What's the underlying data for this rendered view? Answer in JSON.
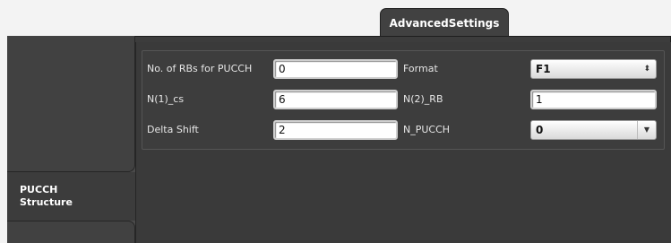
{
  "tabs": {
    "top": "AdvancedSettings",
    "side_line1": "PUCCH",
    "side_line2": "Structure"
  },
  "form": {
    "rbs_label": "No. of RBs for PUCCH",
    "rbs_value": "0",
    "n1cs_label": "N(1)_cs",
    "n1cs_value": "6",
    "delta_label": "Delta Shift",
    "delta_value": "2",
    "format_label": "Format",
    "format_value": "F1",
    "n2rb_label": "N(2)_RB",
    "n2rb_value": "1",
    "npucch_label": "N_PUCCH",
    "npucch_value": "0"
  },
  "icons": {
    "updown": "up-down-arrows-icon",
    "dropdown": "chevron-down-icon"
  }
}
